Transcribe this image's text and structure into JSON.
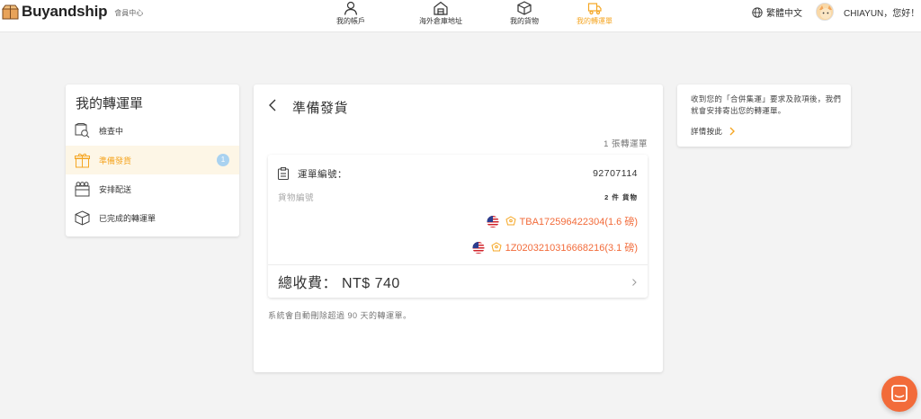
{
  "brand": {
    "name": "Buyandship",
    "subtitle": "會員中心"
  },
  "nav": [
    {
      "label": "我的帳戶",
      "icon": "user-icon",
      "active": false
    },
    {
      "label": "海外倉庫地址",
      "icon": "warehouse-icon",
      "active": false
    },
    {
      "label": "我的貨物",
      "icon": "package-icon",
      "active": false
    },
    {
      "label": "我的轉運單",
      "icon": "shipment-icon",
      "active": true
    }
  ],
  "language": {
    "label": "繁體中文",
    "icon": "globe-icon"
  },
  "user": {
    "greeting": "CHIAYUN，您好！"
  },
  "sidebar": {
    "title": "我的轉運單",
    "items": [
      {
        "label": "檢查中",
        "icon": "inspect-icon",
        "active": false
      },
      {
        "label": "準備發貨",
        "icon": "gift-box-icon",
        "active": true,
        "badge": "1"
      },
      {
        "label": "安排配送",
        "icon": "delivery-icon",
        "active": false
      },
      {
        "label": "已完成的轉運單",
        "icon": "box-icon",
        "active": false
      }
    ]
  },
  "main": {
    "title": "準備發貨",
    "count": "1 張轉運單",
    "card": {
      "order_label": "運單編號：",
      "order_number": "92707114",
      "goods_label": "貨物編號",
      "goods_count": "2 件 貨物",
      "tracking": [
        {
          "text": "TBA172596422304(1.6 磅)",
          "flag": "us-flag-icon"
        },
        {
          "text": "1Z0203210316668216(3.1 磅)",
          "flag": "us-flag-icon"
        }
      ],
      "total": "總收費： NT$ 740"
    },
    "note": "系統會自動刪除超過 90 天的轉運單。"
  },
  "info": {
    "text": "收到您的「合併集運」要求及款項後，我們就會安排寄出您的轉運單。",
    "link": "詳情按此"
  },
  "colors": {
    "accent": "#f5a623",
    "orange": "#f26b3a",
    "badge": "#a9d2f0"
  }
}
